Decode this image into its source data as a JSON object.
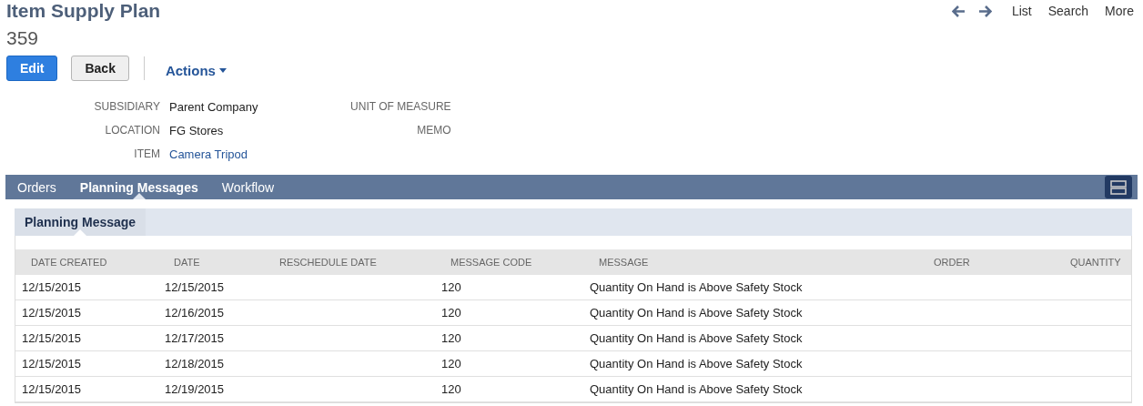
{
  "record": {
    "type": "Item Supply Plan",
    "number": "359"
  },
  "nav": {
    "links": [
      "List",
      "Search",
      "More"
    ]
  },
  "buttons": [
    {
      "label": "Edit",
      "kind": "primary"
    },
    {
      "label": "Back",
      "kind": "secondary"
    }
  ],
  "actions_menu": {
    "label": "Actions"
  },
  "field_columns": [
    [
      {
        "label": "SUBSIDIARY",
        "value": "Parent Company",
        "kind": "text"
      },
      {
        "label": "LOCATION",
        "value": "FG Stores",
        "kind": "text"
      },
      {
        "label": "ITEM",
        "value": "Camera Tripod",
        "kind": "link"
      }
    ],
    [
      {
        "label": "UNIT OF MEASURE"
      },
      {
        "label": "MEMO"
      }
    ]
  ],
  "tabs": [
    {
      "label": "Orders",
      "selected": false
    },
    {
      "label": "Planning Messages",
      "selected": true
    },
    {
      "label": "Workflow",
      "selected": false
    }
  ],
  "subtabs": [
    {
      "label": "Planning Message",
      "selected": true
    }
  ],
  "table": {
    "columns": [
      "DATE CREATED",
      "DATE",
      "RESCHEDULE DATE",
      "MESSAGE CODE",
      "MESSAGE",
      "ORDER",
      "QUANTITY"
    ],
    "rows": [
      [
        "12/15/2015",
        "12/15/2015",
        "",
        "120",
        "Quantity On Hand is Above Safety Stock",
        "",
        ""
      ],
      [
        "12/15/2015",
        "12/16/2015",
        "",
        "120",
        "Quantity On Hand is Above Safety Stock",
        "",
        ""
      ],
      [
        "12/15/2015",
        "12/17/2015",
        "",
        "120",
        "Quantity On Hand is Above Safety Stock",
        "",
        ""
      ],
      [
        "12/15/2015",
        "12/18/2015",
        "",
        "120",
        "Quantity On Hand is Above Safety Stock",
        "",
        ""
      ],
      [
        "12/15/2015",
        "12/19/2015",
        "",
        "120",
        "Quantity On Hand is Above Safety Stock",
        "",
        ""
      ]
    ]
  }
}
